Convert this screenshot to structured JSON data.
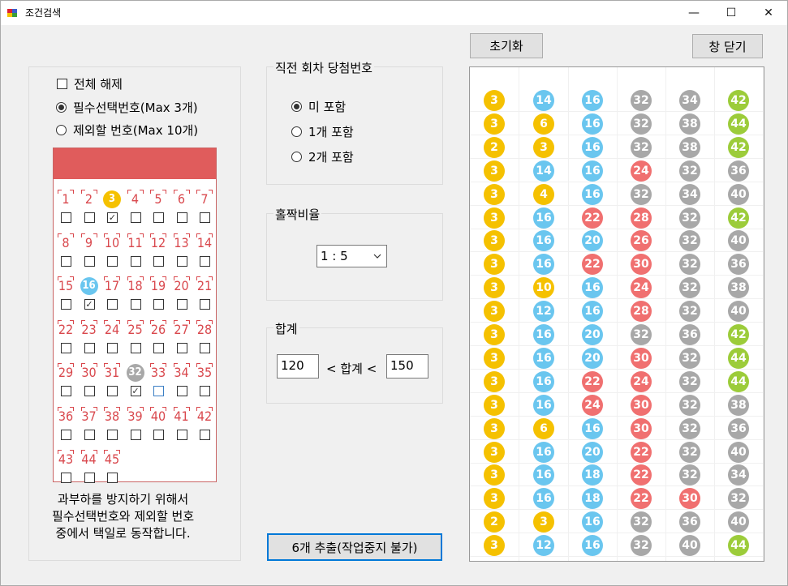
{
  "window": {
    "title": "조건검색",
    "min": "—",
    "max": "☐",
    "close": "✕"
  },
  "options": {
    "clear_all": "전체 해제",
    "required_label": "필수선택번호(Max 3개)",
    "exclude_label": "제외할 번호(Max 10개)",
    "selected_mode": "required"
  },
  "colors": {
    "yellow": "#f5c100",
    "blue": "#6ac6ef",
    "red": "#f07070",
    "gray": "#a8a8a8",
    "green": "#9ccc3a",
    "card_red": "#e05c5c"
  },
  "card": {
    "numbers": [
      "1",
      "2",
      "3",
      "4",
      "5",
      "6",
      "7",
      "8",
      "9",
      "10",
      "11",
      "12",
      "13",
      "14",
      "15",
      "16",
      "17",
      "18",
      "19",
      "20",
      "21",
      "22",
      "23",
      "24",
      "25",
      "26",
      "27",
      "28",
      "29",
      "30",
      "31",
      "32",
      "33",
      "34",
      "35",
      "36",
      "37",
      "38",
      "39",
      "40",
      "41",
      "42",
      "43",
      "44",
      "45"
    ],
    "checked": [
      3,
      16,
      32
    ]
  },
  "prev_draw": {
    "legend": "직전 회차 당첨번호",
    "options": [
      "미 포함",
      "1개 포함",
      "2개 포함"
    ],
    "selected": 0
  },
  "odd_even": {
    "legend": "홀짝비율",
    "value": "1 : 5"
  },
  "sum": {
    "legend": "합계",
    "min": "120",
    "label": "< 합계 <",
    "max": "150"
  },
  "note": [
    "과부하를 방지하기 위해서",
    "필수선택번호와 제외할 번호",
    "중에서 택일로 동작합니다."
  ],
  "buttons": {
    "reset": "초기화",
    "close": "창 닫기",
    "extract": "6개 추출(작업중지 불가)"
  },
  "results": [
    [
      3,
      14,
      16,
      32,
      34,
      42
    ],
    [
      3,
      6,
      16,
      32,
      38,
      44
    ],
    [
      2,
      3,
      16,
      32,
      38,
      42
    ],
    [
      3,
      14,
      16,
      24,
      32,
      36
    ],
    [
      3,
      4,
      16,
      32,
      34,
      40
    ],
    [
      3,
      16,
      22,
      28,
      32,
      42
    ],
    [
      3,
      16,
      20,
      26,
      32,
      40
    ],
    [
      3,
      16,
      22,
      30,
      32,
      36
    ],
    [
      3,
      10,
      16,
      24,
      32,
      38
    ],
    [
      3,
      12,
      16,
      28,
      32,
      40
    ],
    [
      3,
      16,
      20,
      32,
      36,
      42
    ],
    [
      3,
      16,
      20,
      30,
      32,
      44
    ],
    [
      3,
      16,
      22,
      24,
      32,
      44
    ],
    [
      3,
      16,
      24,
      30,
      32,
      38
    ],
    [
      3,
      6,
      16,
      30,
      32,
      36
    ],
    [
      3,
      16,
      20,
      22,
      32,
      40
    ],
    [
      3,
      16,
      18,
      22,
      32,
      34
    ],
    [
      3,
      16,
      18,
      22,
      30,
      32
    ],
    [
      2,
      3,
      16,
      32,
      36,
      40
    ],
    [
      3,
      12,
      16,
      32,
      40,
      44
    ]
  ]
}
